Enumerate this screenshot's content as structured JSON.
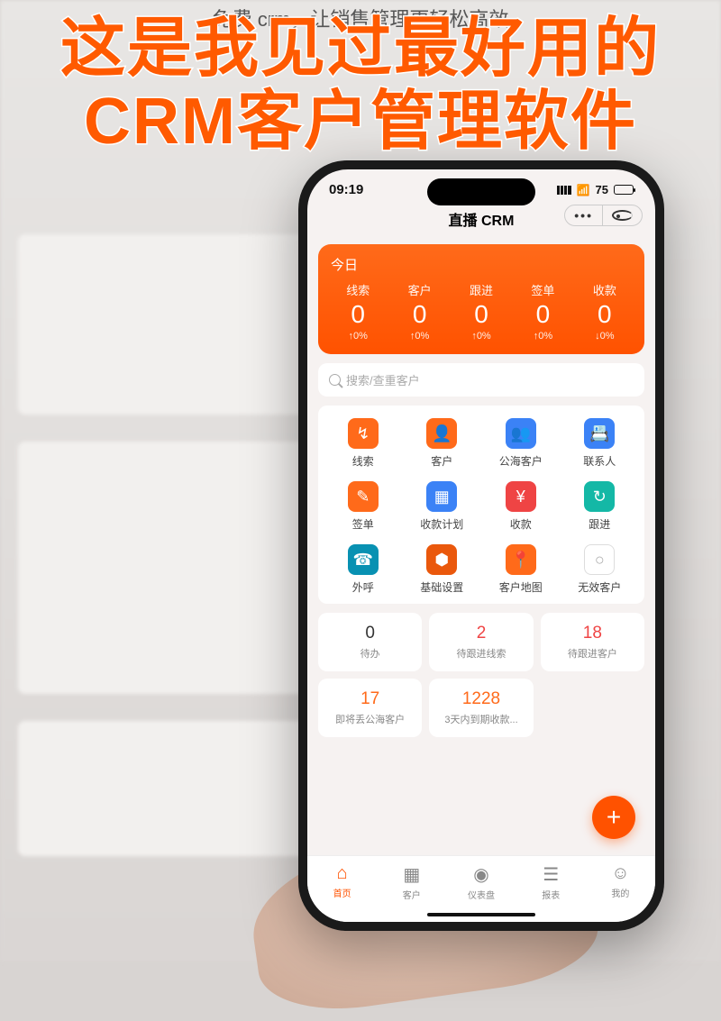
{
  "caption": "免费 crm，让销售管理更轻松高效",
  "headline_line1": "这是我见过最好用的",
  "headline_line2": "CRM客户管理软件",
  "status": {
    "time": "09:19",
    "battery": "75"
  },
  "app_title": "直播 CRM",
  "stats": {
    "title": "今日",
    "items": [
      {
        "label": "线索",
        "value": "0",
        "delta": "↑0%"
      },
      {
        "label": "客户",
        "value": "0",
        "delta": "↑0%"
      },
      {
        "label": "跟进",
        "value": "0",
        "delta": "↑0%"
      },
      {
        "label": "签单",
        "value": "0",
        "delta": "↑0%"
      },
      {
        "label": "收款",
        "value": "0",
        "delta": "↓0%"
      }
    ]
  },
  "search_placeholder": "搜索/查重客户",
  "quick": [
    {
      "label": "线索",
      "icon": "↯",
      "color": "c-orange"
    },
    {
      "label": "客户",
      "icon": "👤",
      "color": "c-orange"
    },
    {
      "label": "公海客户",
      "icon": "👥",
      "color": "c-blue"
    },
    {
      "label": "联系人",
      "icon": "📇",
      "color": "c-blue"
    },
    {
      "label": "签单",
      "icon": "✎",
      "color": "c-orange"
    },
    {
      "label": "收款计划",
      "icon": "▦",
      "color": "c-blue"
    },
    {
      "label": "收款",
      "icon": "¥",
      "color": "c-red"
    },
    {
      "label": "跟进",
      "icon": "↻",
      "color": "c-teal"
    },
    {
      "label": "外呼",
      "icon": "☎",
      "color": "c-cyan"
    },
    {
      "label": "基础设置",
      "icon": "⬢",
      "color": "c-dorange"
    },
    {
      "label": "客户地图",
      "icon": "📍",
      "color": "c-orange"
    },
    {
      "label": "无效客户",
      "icon": "○",
      "color": "c-white"
    }
  ],
  "tiles": [
    {
      "num": "0",
      "label": "待办",
      "cls": ""
    },
    {
      "num": "2",
      "label": "待跟进线索",
      "cls": "red"
    },
    {
      "num": "18",
      "label": "待跟进客户",
      "cls": "red"
    },
    {
      "num": "17",
      "label": "即将丢公海客户",
      "cls": "orange"
    },
    {
      "num": "1228",
      "label": "3天内到期收款...",
      "cls": "orange"
    }
  ],
  "tabs": [
    {
      "label": "首页",
      "icon": "⌂",
      "active": true
    },
    {
      "label": "客户",
      "icon": "▦",
      "active": false
    },
    {
      "label": "仪表盘",
      "icon": "◉",
      "active": false
    },
    {
      "label": "报表",
      "icon": "☰",
      "active": false
    },
    {
      "label": "我的",
      "icon": "☺",
      "active": false
    }
  ]
}
